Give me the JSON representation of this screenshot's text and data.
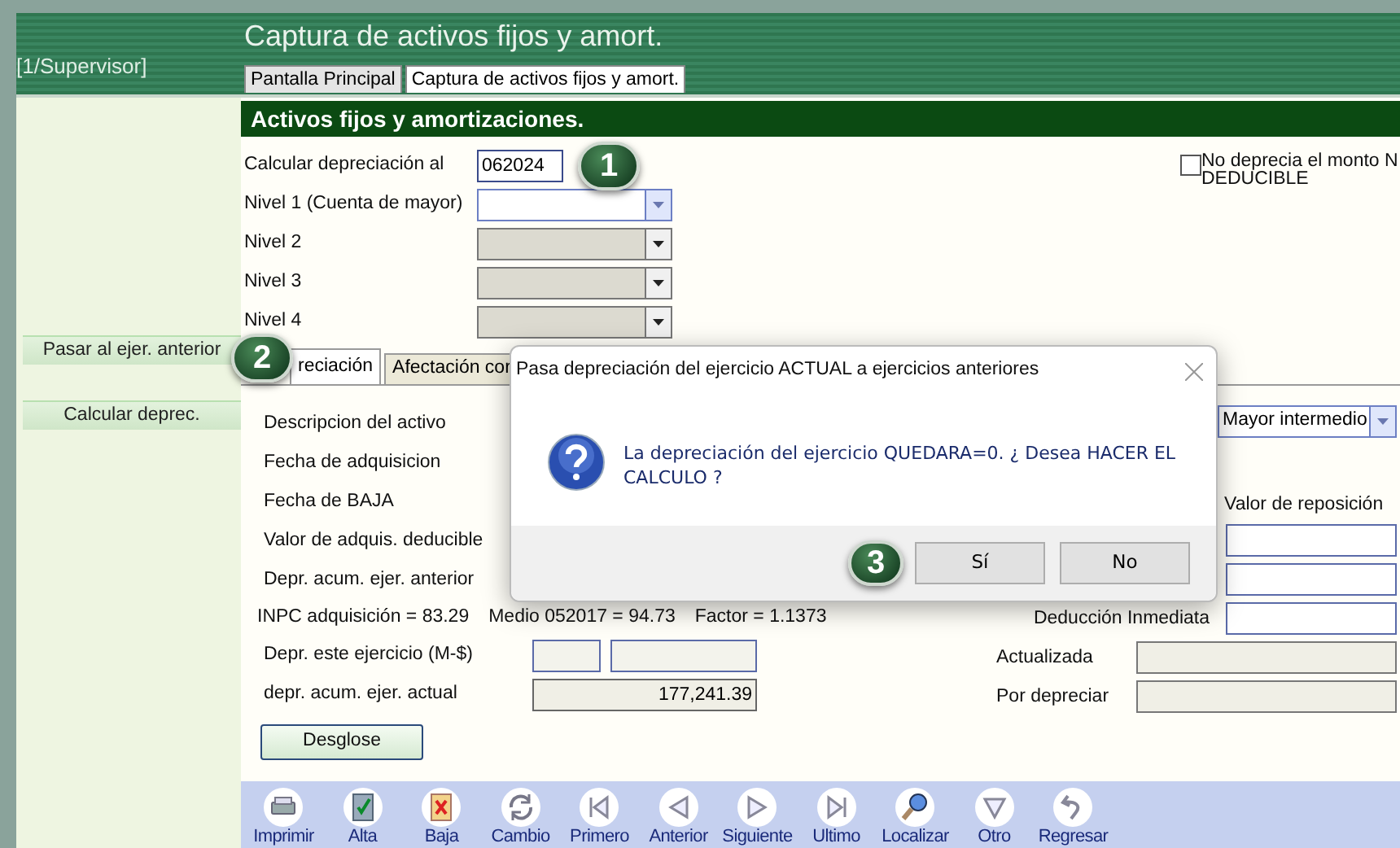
{
  "window": {
    "title": "Captura de activos fijos y amort.",
    "user": "[1/Supervisor]"
  },
  "tabs": [
    {
      "label": "Pantalla Principal",
      "selected": false
    },
    {
      "label": "Captura de activos fijos y amort.",
      "selected": true
    }
  ],
  "sidebar": {
    "buttons": [
      "Pasar al ejer. anterior",
      "Calcular deprec."
    ]
  },
  "section_title": "Activos fijos y amortizaciones.",
  "header_fields": [
    {
      "kind": "text",
      "label": "Calcular depreciación al",
      "value": "062024"
    },
    {
      "kind": "dropdown",
      "label": "Nivel 1 (Cuenta de mayor)",
      "disabled": false
    },
    {
      "kind": "dropdown",
      "label": "Nivel 2",
      "disabled": true
    },
    {
      "kind": "dropdown",
      "label": "Nivel 3",
      "disabled": true
    },
    {
      "kind": "dropdown",
      "label": "Nivel 4",
      "disabled": true
    }
  ],
  "no_deducible_checkbox": {
    "label": "No deprecia el monto N\nDEDUCIBLE",
    "checked": false
  },
  "detail_tabs": [
    {
      "label": "reciación",
      "selected": true
    },
    {
      "label": "Afectación cor",
      "selected": false
    }
  ],
  "type_dropdown": {
    "value": "Mayor intermedio"
  },
  "detail_labels": [
    "Descripcion del activo",
    "Fecha de adquisicion",
    "Fecha de BAJA",
    "Valor de adquis. deducible",
    "Depr. acum. ejer. anterior"
  ],
  "inpc_line": [
    "INPC adquisición = 83.29",
    "Medio 052017 = 94.73",
    "Factor = 1.1373"
  ],
  "depr_este_ejercicio": {
    "label": "Depr. este ejercicio (M-$)"
  },
  "depr_acum_actual": {
    "label": "depr. acum. ejer. actual",
    "value": "177,241.39"
  },
  "desglose_button": "Desglose",
  "replacement": {
    "heading": "Valor de reposición",
    "deduccion_label": "Deducción Inmediata",
    "actualizada_label": "Actualizada",
    "por_depreciar_label": "Por depreciar"
  },
  "toolbar": [
    {
      "label": "Imprimir",
      "kind": "printer"
    },
    {
      "label": "Alta",
      "kind": "check"
    },
    {
      "label": "Baja",
      "kind": "cross"
    },
    {
      "label": "Cambio",
      "kind": "refresh"
    },
    {
      "label": "Primero",
      "kind": "first"
    },
    {
      "label": "Anterior",
      "kind": "prev"
    },
    {
      "label": "Siguiente",
      "kind": "next"
    },
    {
      "label": "Ultimo",
      "kind": "last"
    },
    {
      "label": "Localizar",
      "kind": "search"
    },
    {
      "label": "Otro",
      "kind": "down"
    },
    {
      "label": "Regresar",
      "kind": "back"
    }
  ],
  "dialog": {
    "title": "Pasa depreciación del ejercicio ACTUAL a ejercicios anteriores",
    "message": "La depreciación del ejercicio QUEDARA=0. ¿ Desea HACER EL CALCULO ?",
    "buttons": [
      "Sí",
      "No"
    ]
  },
  "callouts": [
    "1",
    "2",
    "3"
  ]
}
